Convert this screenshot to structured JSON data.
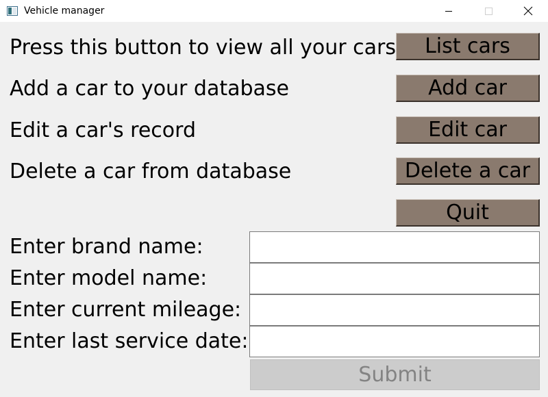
{
  "window": {
    "title": "Vehicle manager",
    "app_icon": "window-app-icon",
    "controls": {
      "minimize": "minimize-icon",
      "maximize": "maximize-icon",
      "close": "close-icon"
    }
  },
  "actions": [
    {
      "label": "Press this button to view all your cars",
      "button": "List cars"
    },
    {
      "label": "Add a car to your database",
      "button": "Add car"
    },
    {
      "label": "Edit a car's record",
      "button": "Edit car"
    },
    {
      "label": "Delete a car from database",
      "button": "Delete a car"
    }
  ],
  "quit_button": "Quit",
  "form": {
    "fields": [
      {
        "label": "Enter brand name:",
        "value": ""
      },
      {
        "label": "Enter model name:",
        "value": ""
      },
      {
        "label": "Enter current mileage:",
        "value": ""
      },
      {
        "label": "Enter last service date:",
        "value": ""
      }
    ],
    "submit_label": "Submit",
    "submit_enabled": false
  },
  "colors": {
    "window_bg": "#f0f0f0",
    "titlebar_bg": "#ffffff",
    "action_button_bg": "#8a7a6e",
    "submit_disabled_bg": "#cccccc",
    "submit_disabled_text": "#838383"
  }
}
